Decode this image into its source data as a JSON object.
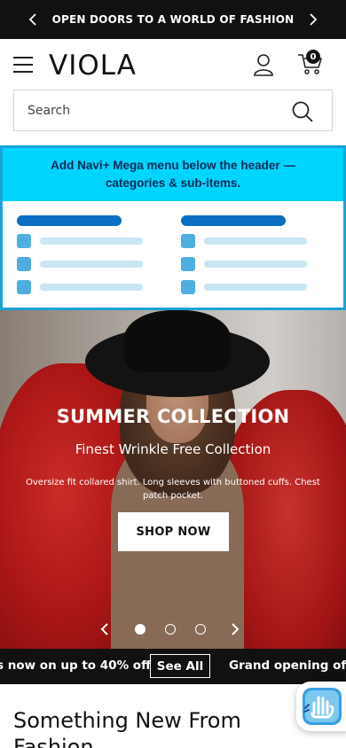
{
  "announcement": {
    "text": "OPEN DOORS TO A WORLD OF FASHION",
    "prev_icon": "chevron-left-icon",
    "next_icon": "chevron-right-icon"
  },
  "header": {
    "logo_text": "VIOLA",
    "menu_icon": "hamburger-menu-icon",
    "account_icon": "user-icon",
    "cart_icon": "shopping-cart-icon",
    "cart_count": "0"
  },
  "search": {
    "placeholder": "Search",
    "icon": "search-icon"
  },
  "mega_menu_placeholder": {
    "message": "Add Navi+ Mega menu below the header — categories & sub-items.",
    "accent_color": "#00d4ff",
    "border_color": "#1aa3d6"
  },
  "hero": {
    "title": "SUMMER COLLECTION",
    "subtitle": "Finest Wrinkle Free Collection",
    "description": "Oversize fit collared shirt. Long sleeves with buttoned cuffs. Chest patch pocket.",
    "cta_label": "SHOP NOW",
    "slide_count": 3,
    "active_slide": 1
  },
  "promo_bar": {
    "text_left": "s now on up to 40% off",
    "see_all_label": "See All",
    "text_right": "Grand opening off"
  },
  "section": {
    "title": "Something New From Fashion"
  },
  "accessibility_widget": {
    "icon": "accessibility-hand-icon"
  }
}
